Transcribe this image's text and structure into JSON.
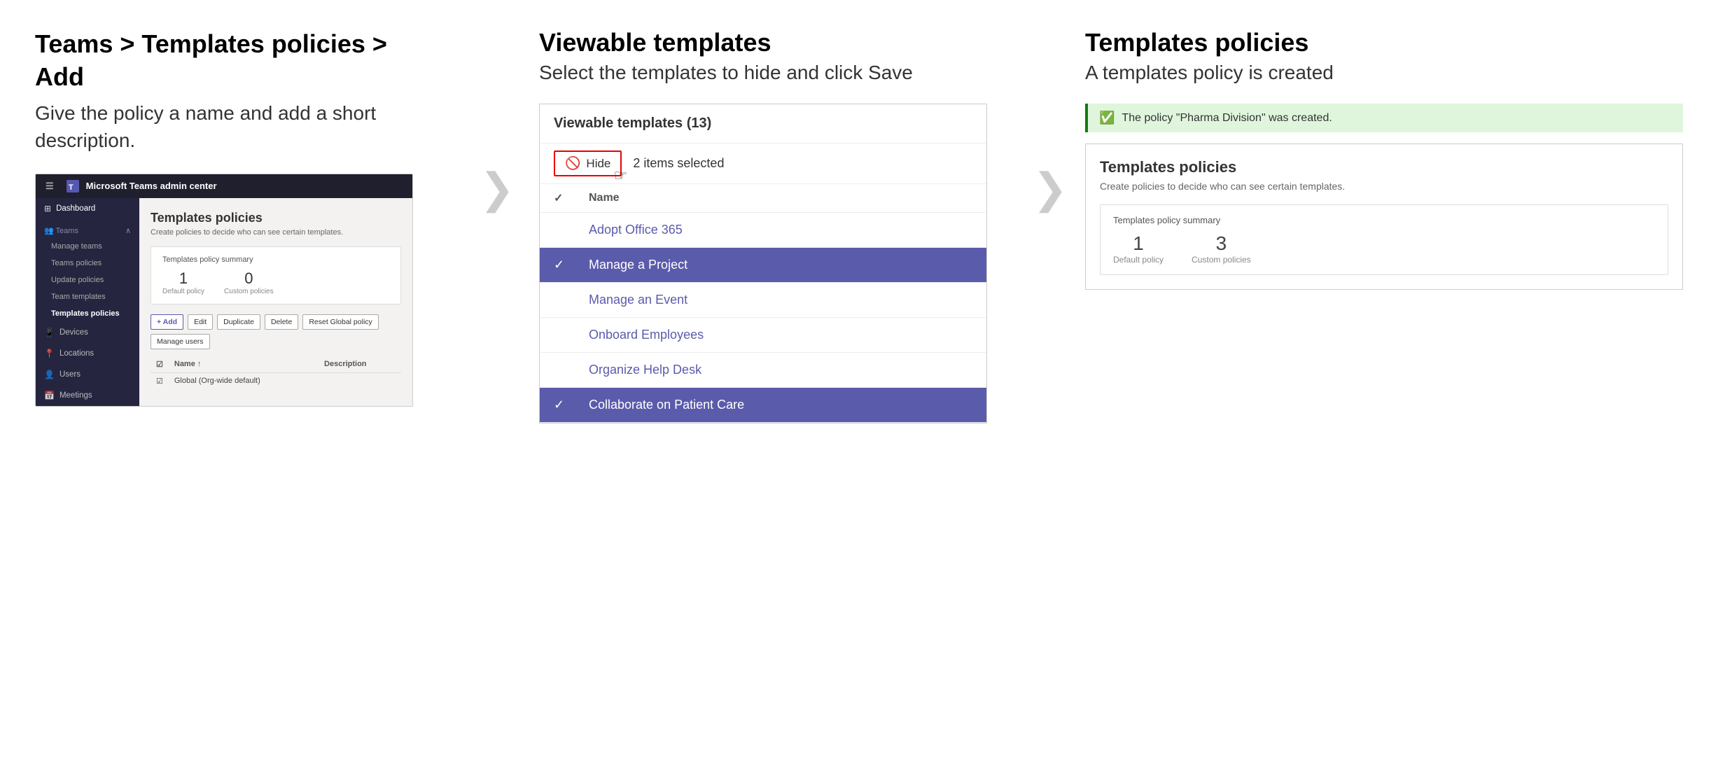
{
  "col1": {
    "heading_prefix": "Teams > Templates policies > ",
    "heading_bold": "Add",
    "subtext": "Give the policy a name and add a short description.",
    "admin_center": {
      "topbar_title": "Microsoft Teams admin center",
      "hamburger": "☰",
      "sidebar": {
        "items": [
          {
            "label": "Dashboard",
            "icon": "⊞"
          },
          {
            "label": "Teams",
            "icon": "👥",
            "expanded": true
          },
          {
            "label": "Manage teams",
            "sub": true
          },
          {
            "label": "Teams policies",
            "sub": true
          },
          {
            "label": "Update policies",
            "sub": true
          },
          {
            "label": "Team templates",
            "sub": true
          },
          {
            "label": "Templates policies",
            "sub": true,
            "active": true
          },
          {
            "label": "Devices",
            "icon": "📱"
          },
          {
            "label": "Locations",
            "icon": "📍"
          },
          {
            "label": "Users",
            "icon": "👤"
          },
          {
            "label": "Meetings",
            "icon": "📅"
          }
        ]
      },
      "main": {
        "page_title": "Templates policies",
        "page_desc": "Create policies to decide who can see certain templates.",
        "summary_title": "Templates policy summary",
        "default_policy_num": "1",
        "default_policy_lbl": "Default policy",
        "custom_policy_num": "0",
        "custom_policy_lbl": "Custom policies",
        "toolbar_add": "+ Add",
        "toolbar_edit": "Edit",
        "toolbar_duplicate": "Duplicate",
        "toolbar_delete": "Delete",
        "toolbar_reset": "Reset Global policy",
        "toolbar_manage": "Manage users",
        "table_col_name": "Name ↑",
        "table_col_desc": "Description",
        "table_row1_name": "Global (Org-wide default)",
        "table_row1_desc": ""
      }
    }
  },
  "arrow1": "❯",
  "col2": {
    "heading": "Viewable templates",
    "subtext": "Select the templates to hide and click Save",
    "panel": {
      "title": "Viewable templates (13)",
      "hide_btn_label": "Hide",
      "items_selected": "2 items selected",
      "col_name": "Name",
      "rows": [
        {
          "name": "Adopt Office 365",
          "selected": false,
          "checked": false
        },
        {
          "name": "Manage a Project",
          "selected": true,
          "checked": true
        },
        {
          "name": "Manage an Event",
          "selected": false,
          "checked": false
        },
        {
          "name": "Onboard Employees",
          "selected": false,
          "checked": false
        },
        {
          "name": "Organize Help Desk",
          "selected": false,
          "checked": false
        },
        {
          "name": "Collaborate on Patient Care",
          "selected": true,
          "checked": true
        }
      ]
    }
  },
  "arrow2": "❯",
  "col3": {
    "heading": "Templates policies",
    "subtext": "A templates policy is created",
    "success_msg": "The policy \"Pharma Division\" was created.",
    "result_title": "Templates policies",
    "result_desc": "Create policies to decide who can see certain templates.",
    "summary_title": "Templates policy summary",
    "default_num": "1",
    "default_lbl": "Default policy",
    "custom_num": "3",
    "custom_lbl": "Custom policies"
  }
}
